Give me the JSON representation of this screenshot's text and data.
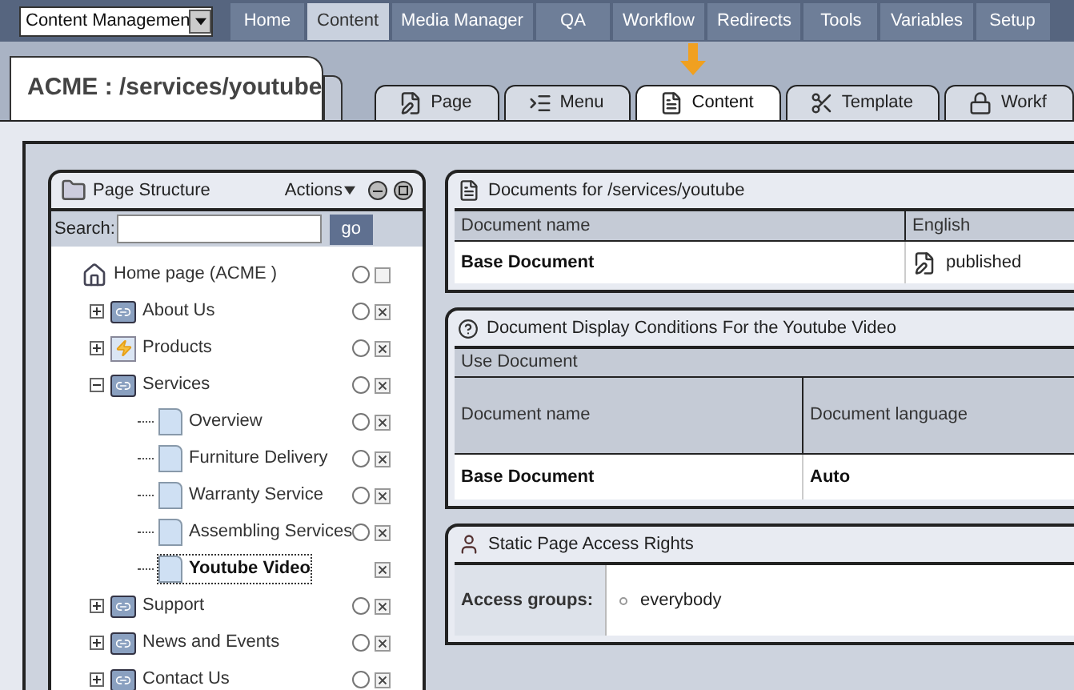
{
  "module_select": {
    "value": "Content Managemen"
  },
  "nav": [
    {
      "label": "Home",
      "selected": false
    },
    {
      "label": "Content",
      "selected": true
    },
    {
      "label": "Media Manager",
      "selected": false
    },
    {
      "label": "QA",
      "selected": false
    },
    {
      "label": "Workflow",
      "selected": false
    },
    {
      "label": "Redirects",
      "selected": false
    },
    {
      "label": "Tools",
      "selected": false
    },
    {
      "label": "Variables",
      "selected": false
    },
    {
      "label": "Setup",
      "selected": false
    }
  ],
  "page_title": "ACME : /services/youtube",
  "tabs": [
    {
      "label": "Page",
      "kind": "page",
      "selected": false
    },
    {
      "label": "Menu",
      "kind": "menu",
      "selected": false
    },
    {
      "label": "Content",
      "kind": "content",
      "selected": true
    },
    {
      "label": "Template",
      "kind": "template",
      "selected": false
    },
    {
      "label": "Workf",
      "kind": "workflow",
      "selected": false
    }
  ],
  "page_structure": {
    "title": "Page Structure",
    "actions": "Actions",
    "search_label": "Search:",
    "go": "go",
    "tree": [
      {
        "label": "Home page (ACME )",
        "kind": "home",
        "radio_checked": false,
        "delete_box": false,
        "selected": false,
        "children": [
          {
            "label": "About Us",
            "kind": "link",
            "expanded": false,
            "radio_checked": false,
            "delete_box": true,
            "selected": false
          },
          {
            "label": "Products",
            "kind": "flash",
            "expanded": false,
            "radio_checked": false,
            "delete_box": true,
            "selected": false
          },
          {
            "label": "Services",
            "kind": "link",
            "expanded": true,
            "radio_checked": false,
            "delete_box": true,
            "selected": false,
            "children": [
              {
                "label": "Overview",
                "kind": "page",
                "radio_checked": false,
                "delete_box": true,
                "selected": false
              },
              {
                "label": "Furniture Delivery",
                "kind": "page",
                "radio_checked": false,
                "delete_box": true,
                "selected": false
              },
              {
                "label": "Warranty Service",
                "kind": "page",
                "radio_checked": false,
                "delete_box": true,
                "selected": false
              },
              {
                "label": "Assembling Services",
                "kind": "page",
                "radio_checked": false,
                "delete_box": true,
                "selected": false
              },
              {
                "label": "Youtube Video",
                "kind": "page",
                "delete_box": true,
                "selected": true
              }
            ]
          },
          {
            "label": "Support",
            "kind": "link",
            "expanded": false,
            "radio_checked": false,
            "delete_box": true,
            "selected": false
          },
          {
            "label": "News and Events",
            "kind": "link",
            "expanded": false,
            "radio_checked": false,
            "delete_box": true,
            "selected": false
          },
          {
            "label": "Contact Us",
            "kind": "link",
            "expanded": false,
            "radio_checked": false,
            "delete_box": true,
            "selected": false
          }
        ]
      }
    ]
  },
  "documents": {
    "title": "Documents for /services/youtube",
    "columns": [
      "Document name",
      "English"
    ],
    "rows": [
      {
        "name": "Base Document",
        "status": "published"
      }
    ]
  },
  "display_conditions": {
    "title": "Document Display Conditions For the Youtube Video",
    "group": "Use Document",
    "columns": [
      "Document name",
      "Document language"
    ],
    "rows": [
      [
        "Base Document",
        "Auto"
      ]
    ]
  },
  "access_rights": {
    "title": "Static Page Access Rights",
    "label": "Access groups:",
    "groups": [
      "everybody"
    ]
  }
}
